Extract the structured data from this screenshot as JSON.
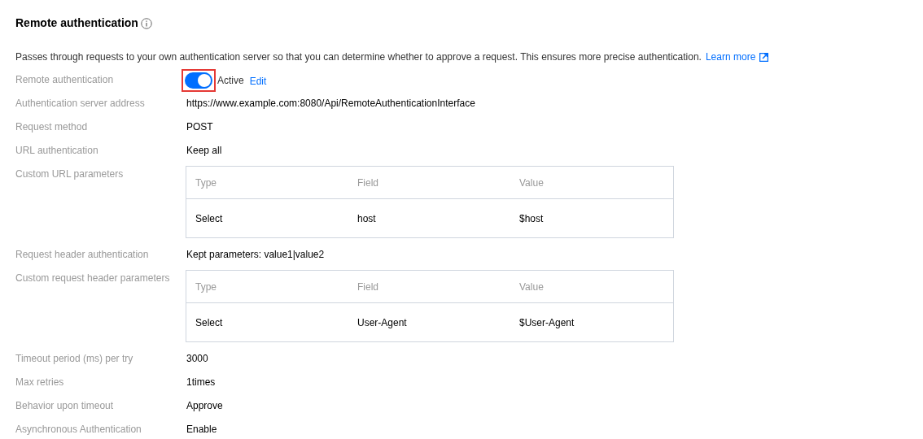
{
  "title": "Remote authentication",
  "description": {
    "text": "Passes through requests to your own authentication server so that you can determine whether to approve a request. This ensures more precise authentication.",
    "link": "Learn more"
  },
  "fields": [
    {
      "kind": "toggle",
      "label": "Remote authentication",
      "on": true,
      "highlighted": true,
      "status": "Active",
      "action": "Edit"
    },
    {
      "kind": "text",
      "label": "Authentication server address",
      "value": "https://www.example.com:8080/Api/RemoteAuthenticationInterface"
    },
    {
      "kind": "text",
      "label": "Request method",
      "value": "POST"
    },
    {
      "kind": "text",
      "label": "URL authentication",
      "value": "Keep all"
    },
    {
      "kind": "table",
      "label": "Custom URL parameters",
      "columns": [
        "Type",
        "Field",
        "Value"
      ],
      "rows": [
        [
          "Select",
          "host",
          "$host"
        ]
      ]
    },
    {
      "kind": "text",
      "label": "Request header authentication",
      "value": "Kept parameters: value1|value2"
    },
    {
      "kind": "table",
      "label": "Custom request header parameters",
      "columns": [
        "Type",
        "Field",
        "Value"
      ],
      "rows": [
        [
          "Select",
          "User-Agent",
          "$User-Agent"
        ]
      ]
    },
    {
      "kind": "text",
      "label": "Timeout period (ms) per try",
      "value": "3000"
    },
    {
      "kind": "text",
      "label": "Max retries",
      "value": "1times"
    },
    {
      "kind": "text",
      "label": "Behavior upon timeout",
      "value": "Approve"
    },
    {
      "kind": "text",
      "label": "Asynchronous Authentication",
      "value": "Enable"
    }
  ]
}
